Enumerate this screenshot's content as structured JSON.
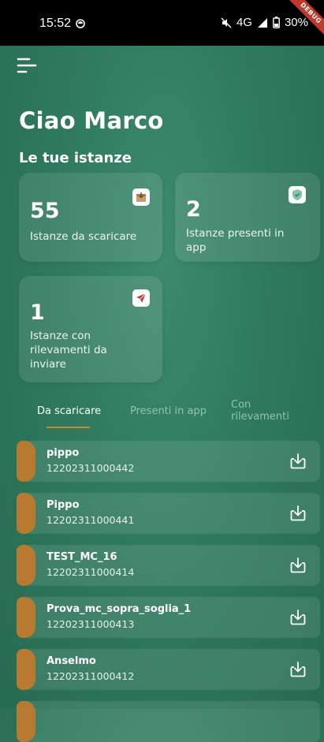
{
  "status_bar": {
    "time": "15:52",
    "network": "4G",
    "battery": "30%",
    "debug_label": "DEBUG"
  },
  "header": {
    "greeting": "Ciao Marco",
    "section_title": "Le tue istanze"
  },
  "cards": [
    {
      "value": "55",
      "label": "Istanze da scaricare",
      "icon": "download-box-icon"
    },
    {
      "value": "2",
      "label": "Istanze presenti in app",
      "icon": "shield-check-icon"
    },
    {
      "value": "1",
      "label": "Istanze con rilevamenti da inviare",
      "icon": "send-icon"
    }
  ],
  "tabs": [
    {
      "label": "Da scaricare",
      "active": true
    },
    {
      "label": "Presenti in app",
      "active": false
    },
    {
      "label": "Con rilevamenti",
      "active": false
    }
  ],
  "items": [
    {
      "name": "pippo",
      "code": "12202311000442"
    },
    {
      "name": "Pippo",
      "code": "12202311000441"
    },
    {
      "name": "TEST_MC_16",
      "code": "12202311000414"
    },
    {
      "name": "Prova_mc_sopra_soglia_1",
      "code": "12202311000413"
    },
    {
      "name": "Anselmo",
      "code": "12202311000412"
    }
  ],
  "colors": {
    "accent": "#b87a30",
    "background": "#2f7a5e",
    "tab_underline": "#c08a3a"
  }
}
